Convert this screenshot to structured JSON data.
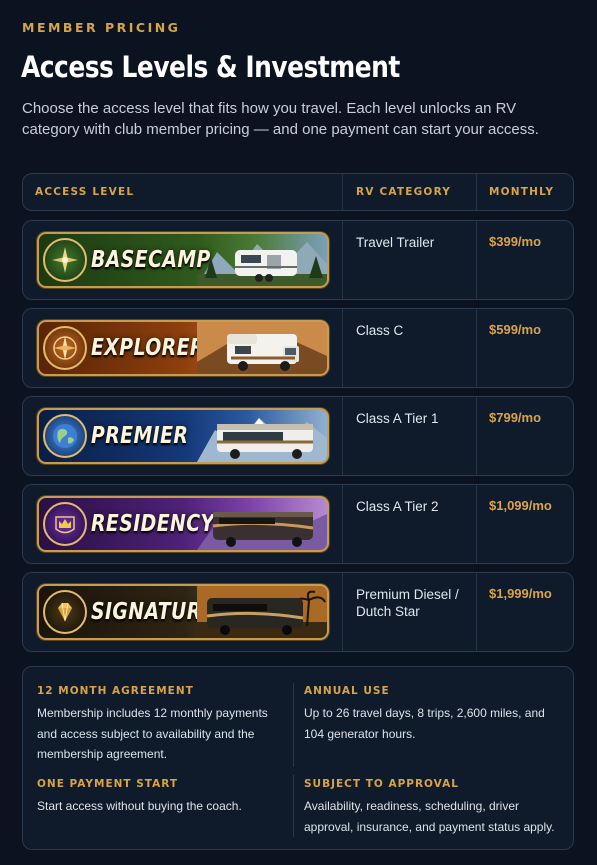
{
  "eyebrow": "MEMBER PRICING",
  "title": "Access Levels & Investment",
  "subtitle": "Choose the access level that fits how you travel. Each level unlocks an RV category with club member pricing — and one payment can start your access.",
  "table": {
    "headers": {
      "level": "ACCESS LEVEL",
      "category": "RV CATEGORY",
      "monthly": "MONTHLY"
    },
    "rows": [
      {
        "tier": "BASECAMP",
        "emblem_icon": "compass-icon",
        "category": "Travel Trailer",
        "price": "$399/mo",
        "accent": "#3c6a2a"
      },
      {
        "tier": "EXPLORER",
        "emblem_icon": "compass-icon",
        "category": "Class C",
        "price": "$599/mo",
        "accent": "#9b4a12"
      },
      {
        "tier": "PREMIER",
        "emblem_icon": "globe-icon",
        "category": "Class A Tier 1",
        "price": "$799/mo",
        "accent": "#163f86"
      },
      {
        "tier": "RESIDENCY",
        "emblem_icon": "crown-icon",
        "category": "Class A Tier 2",
        "price": "$1,099/mo",
        "accent": "#5a2a84"
      },
      {
        "tier": "SIGNATURE",
        "emblem_icon": "diamond-icon",
        "category": "Premium Diesel / Dutch Star",
        "price": "$1,999/mo",
        "accent": "#3a2e18"
      }
    ]
  },
  "info": {
    "agreement": {
      "heading": "12 MONTH AGREEMENT",
      "body": "Membership includes 12 monthly payments and access subject to availability and the membership agreement."
    },
    "annual": {
      "heading": "ANNUAL USE",
      "body": "Up to 26 travel days, 8 trips, 2,600 miles, and 104 generator hours."
    },
    "payment": {
      "heading": "ONE PAYMENT START",
      "body": "Start access without buying the coach."
    },
    "approval": {
      "heading": "SUBJECT TO APPROVAL",
      "body": "Availability, readiness, scheduling, driver approval, insurance, and payment status apply."
    }
  },
  "colors": {
    "accent_gold": "#d7a448",
    "price_gold": "#dba44b",
    "background": "#0b1320"
  }
}
